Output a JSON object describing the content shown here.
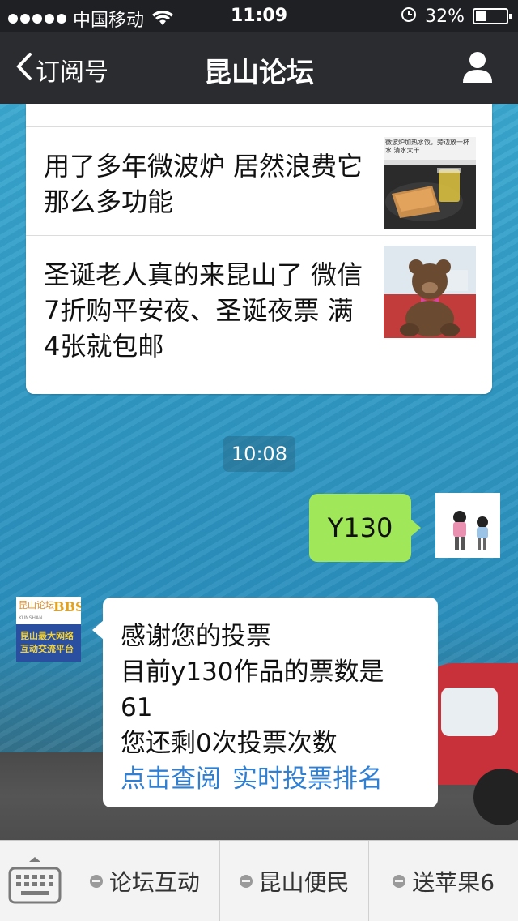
{
  "status_bar": {
    "carrier": "中国移动",
    "time": "11:09",
    "battery_percent": "32%",
    "battery_level": 0.32
  },
  "nav": {
    "back_label": "订阅号",
    "title": "昆山论坛"
  },
  "articles": [
    {
      "title": "用了多年微波炉  居然浪费它那么多功能",
      "thumb_text": "微波炉加热水饭，旁边放一杯水 清水大干"
    },
    {
      "title": "圣诞老人真的来昆山了 微信7折购平安夜、圣诞夜票  满4张就包邮",
      "thumb_text": ""
    }
  ],
  "timestamp": "10:08",
  "outgoing_message": "Y130",
  "incoming_message": {
    "lines": [
      "感谢您的投票",
      "目前y130作品的票数是",
      "61",
      "您还剩0次投票次数"
    ],
    "links": [
      "点击查阅",
      "实时投票排名"
    ]
  },
  "avatar_bbs": {
    "line1": "昆山论坛",
    "line2": "BBS",
    "line3": "KUNSHAN",
    "line4": "昆山最大网络",
    "line5": "互动交流平台"
  },
  "menu": {
    "items": [
      "论坛互动",
      "昆山便民",
      "送苹果6"
    ]
  },
  "colors": {
    "status_bar_bg": "#1f2024",
    "nav_bg": "#2b2c30",
    "outgoing_bubble": "#a0e75a",
    "link": "#2f7fd3"
  }
}
